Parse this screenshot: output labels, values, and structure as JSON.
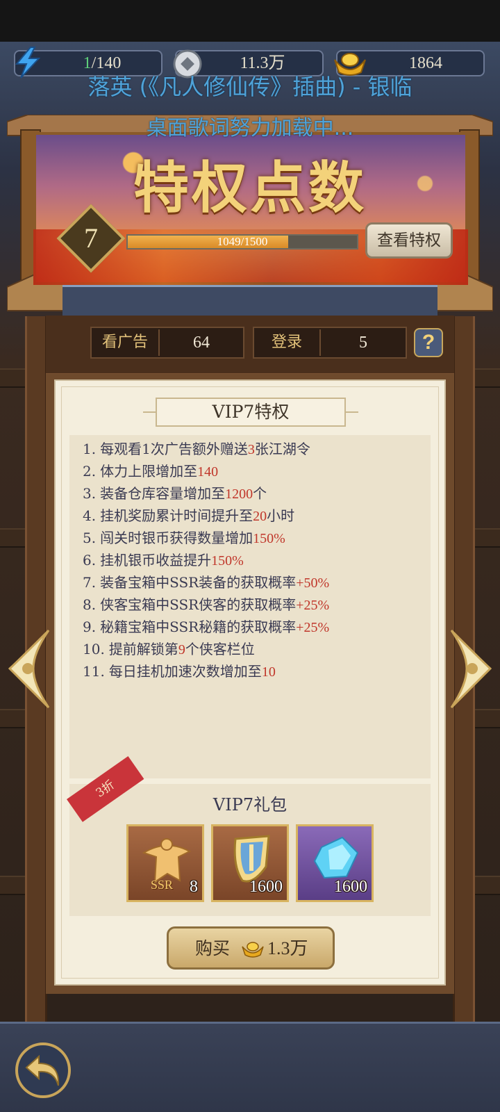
{
  "resources": {
    "energy_current": "1",
    "energy_max": "/140",
    "silver": "11.3万",
    "gold": "1864"
  },
  "lyrics": {
    "line1": "落英 (《凡人修仙传》插曲) - 银临",
    "line2": "桌面歌词努力加载中..."
  },
  "banner": {
    "title": "特权点数",
    "vip_level": "7",
    "progress_text": "1049/1500",
    "progress_value": 0.6993,
    "view_privilege_label": "查看特权"
  },
  "stats": {
    "ad_label": "看广告",
    "ad_value": "64",
    "login_label": "登录",
    "login_value": "5",
    "help_label": "?"
  },
  "vip_panel": {
    "title": "VIP7特权",
    "privileges": [
      {
        "num": "1.",
        "pre": "每观看1次广告额外赠送",
        "hl": "3",
        "post": "张江湖令"
      },
      {
        "num": "2.",
        "pre": "体力上限增加至",
        "hl": "140",
        "post": ""
      },
      {
        "num": "3.",
        "pre": "装备仓库容量增加至",
        "hl": "1200",
        "post": "个"
      },
      {
        "num": "4.",
        "pre": "挂机奖励累计时间提升至",
        "hl": "20",
        "post": "小时"
      },
      {
        "num": "5.",
        "pre": "闯关时银币获得数量增加",
        "hl": "150%",
        "post": ""
      },
      {
        "num": "6.",
        "pre": "挂机银币收益提升",
        "hl": "150%",
        "post": ""
      },
      {
        "num": "7.",
        "pre": "装备宝箱中SSR装备的获取概率",
        "hl": "+50%",
        "post": ""
      },
      {
        "num": "8.",
        "pre": "侠客宝箱中SSR侠客的获取概率",
        "hl": "+25%",
        "post": ""
      },
      {
        "num": "9.",
        "pre": "秘籍宝箱中SSR秘籍的获取概率",
        "hl": "+25%",
        "post": ""
      },
      {
        "num": "10.",
        "pre": "提前解锁第",
        "hl": "9",
        "post": "个侠客栏位"
      },
      {
        "num": "11.",
        "pre": "每日挂机加速次数增加至",
        "hl": "10",
        "post": ""
      }
    ],
    "gift_title": "VIP7礼包",
    "discount": "3折",
    "items": [
      {
        "icon": "ssr-hero-icon",
        "badge": "SSR",
        "count": "8"
      },
      {
        "icon": "shield-sword-icon",
        "count": "1600"
      },
      {
        "icon": "blue-crystal-icon",
        "count": "1600"
      }
    ],
    "buy_label": "购买",
    "buy_price": "1.3万"
  },
  "colors": {
    "highlight": "#c0362a",
    "accent_gold": "#c9a55a",
    "energy_green": "#5fd07a"
  }
}
